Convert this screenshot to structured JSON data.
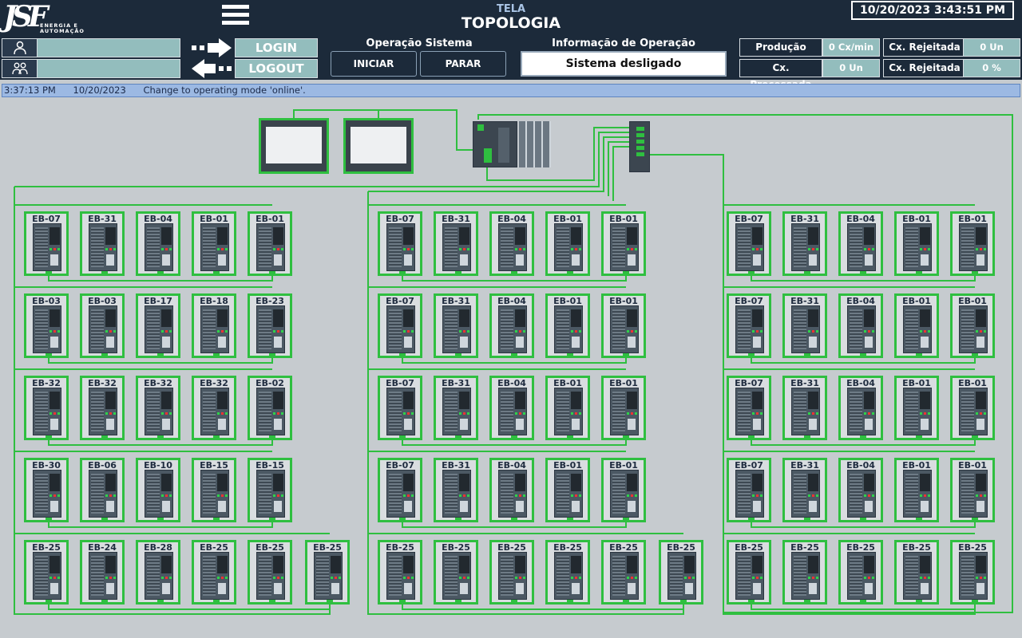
{
  "header": {
    "logo_text": "JSF",
    "logo_subtitle": "ENERGIA E AUTOMAÇÃO",
    "title_top": "TELA",
    "title_main": "TOPOLOGIA",
    "datetime": "10/20/2023 3:43:51 PM"
  },
  "login": {
    "login_label": "LOGIN",
    "logout_label": "LOGOUT",
    "user_field": "",
    "group_field": ""
  },
  "operation": {
    "title": "Operação Sistema",
    "start_label": "INICIAR",
    "stop_label": "PARAR"
  },
  "info": {
    "title": "Informação de Operação",
    "status": "Sistema desligado"
  },
  "kpis": {
    "producao_label": "Produção",
    "producao_value": "0 Cx/min",
    "processada_label": "Cx. Processada",
    "processada_value": "0 Un",
    "rejeitada_un_label": "Cx. Rejeitada",
    "rejeitada_un_value": "0 Un",
    "rejeitada_pct_label": "Cx. Rejeitada",
    "rejeitada_pct_value": "0 %"
  },
  "alarm": {
    "time": "3:37:13 PM",
    "date": "10/20/2023",
    "message": "Change to operating mode 'online'."
  },
  "colors": {
    "link_green": "#2fbf40",
    "header_bg": "#1c2a3a",
    "teal_field": "#93bdbd"
  },
  "topology": {
    "groups": [
      {
        "rows": [
          [
            "EB-07",
            "EB-31",
            "EB-04",
            "EB-01",
            "EB-01"
          ],
          [
            "EB-03",
            "EB-03",
            "EB-17",
            "EB-18",
            "EB-23"
          ],
          [
            "EB-32",
            "EB-32",
            "EB-32",
            "EB-32",
            "EB-02"
          ],
          [
            "EB-30",
            "EB-06",
            "EB-10",
            "EB-15",
            "EB-15"
          ],
          [
            "EB-25",
            "EB-24",
            "EB-28",
            "EB-25",
            "EB-25",
            "EB-25"
          ]
        ]
      },
      {
        "rows": [
          [
            "EB-07",
            "EB-31",
            "EB-04",
            "EB-01",
            "EB-01"
          ],
          [
            "EB-07",
            "EB-31",
            "EB-04",
            "EB-01",
            "EB-01"
          ],
          [
            "EB-07",
            "EB-31",
            "EB-04",
            "EB-01",
            "EB-01"
          ],
          [
            "EB-07",
            "EB-31",
            "EB-04",
            "EB-01",
            "EB-01"
          ],
          [
            "EB-25",
            "EB-25",
            "EB-25",
            "EB-25",
            "EB-25",
            "EB-25"
          ]
        ]
      },
      {
        "rows": [
          [
            "EB-07",
            "EB-31",
            "EB-04",
            "EB-01",
            "EB-01"
          ],
          [
            "EB-07",
            "EB-31",
            "EB-04",
            "EB-01",
            "EB-01"
          ],
          [
            "EB-07",
            "EB-31",
            "EB-04",
            "EB-01",
            "EB-01"
          ],
          [
            "EB-07",
            "EB-31",
            "EB-04",
            "EB-01",
            "EB-01"
          ],
          [
            "EB-25",
            "EB-25",
            "EB-25",
            "EB-25",
            "EB-25"
          ]
        ]
      }
    ]
  }
}
